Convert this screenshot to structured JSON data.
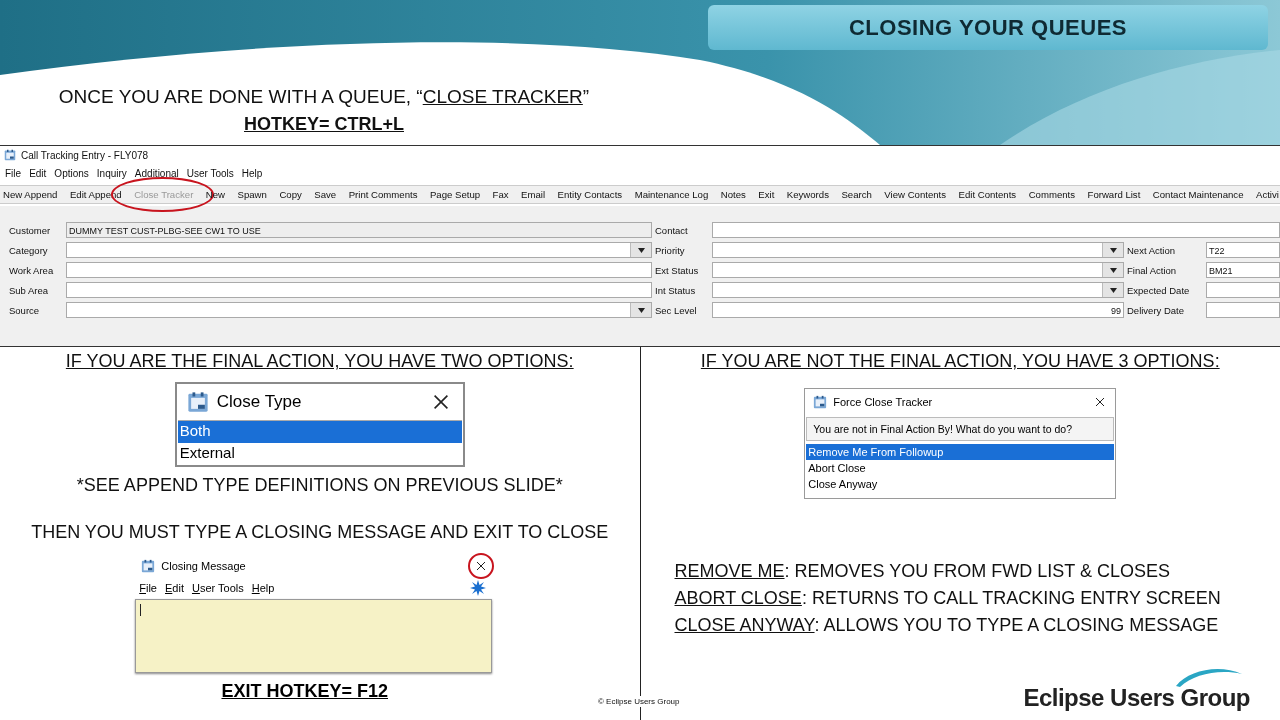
{
  "slide": {
    "title": "CLOSING YOUR QUEUES",
    "intro": {
      "before": "ONCE YOU ARE DONE WITH A QUEUE, “",
      "underlined": "CLOSE TRACKER",
      "after": "”"
    },
    "hotkey": "HOTKEY= CTRL+L"
  },
  "window": {
    "title": "Call Tracking Entry - FLY078",
    "menu": [
      "File",
      "Edit",
      "Options",
      "Inquiry",
      "Additional",
      "User Tools",
      "Help"
    ],
    "toolbar": [
      {
        "label": "New Append",
        "disabled": false,
        "circled": false
      },
      {
        "label": "Edit Append",
        "disabled": false,
        "circled": false
      },
      {
        "label": "Close Tracker",
        "disabled": true,
        "circled": true
      },
      {
        "label": "New",
        "disabled": false,
        "circled": false
      },
      {
        "label": "Spawn",
        "disabled": false,
        "circled": false
      },
      {
        "label": "Copy",
        "disabled": false,
        "circled": false
      },
      {
        "label": "Save",
        "disabled": false,
        "circled": false
      },
      {
        "label": "Print Comments",
        "disabled": false,
        "circled": false
      },
      {
        "label": "Page Setup",
        "disabled": false,
        "circled": false
      },
      {
        "label": "Fax",
        "disabled": false,
        "circled": false
      },
      {
        "label": "Email",
        "disabled": false,
        "circled": false
      },
      {
        "label": "Entity Contacts",
        "disabled": false,
        "circled": false
      },
      {
        "label": "Maintenance Log",
        "disabled": false,
        "circled": false
      },
      {
        "label": "Notes",
        "disabled": false,
        "circled": false
      },
      {
        "label": "Exit",
        "disabled": false,
        "circled": false
      },
      {
        "label": "Keywords",
        "disabled": false,
        "circled": false
      },
      {
        "label": "Search",
        "disabled": false,
        "circled": false
      },
      {
        "label": "View Contents",
        "disabled": false,
        "circled": false
      },
      {
        "label": "Edit Contents",
        "disabled": false,
        "circled": false
      },
      {
        "label": "Comments",
        "disabled": false,
        "circled": false
      },
      {
        "label": "Forward List",
        "disabled": false,
        "circled": false
      },
      {
        "label": "Contact Maintenance",
        "disabled": false,
        "circled": false
      },
      {
        "label": "Activi",
        "disabled": false,
        "circled": false
      }
    ],
    "fields_left": [
      {
        "label": "Customer",
        "value": "DUMMY TEST CUST-PLBG-SEE CW1 TO USE",
        "kind": "readonly"
      },
      {
        "label": "Category",
        "kind": "dropdown"
      },
      {
        "label": "Work Area",
        "kind": "text"
      },
      {
        "label": "Sub Area",
        "kind": "text"
      },
      {
        "label": "Source",
        "kind": "dropdown"
      }
    ],
    "fields_middle": [
      {
        "label": "Contact",
        "kind": "text"
      },
      {
        "label": "Priority",
        "kind": "dropdown"
      },
      {
        "label": "Ext Status",
        "kind": "dropdown"
      },
      {
        "label": "Int Status",
        "kind": "dropdown"
      },
      {
        "label": "Sec Level",
        "value": "99",
        "kind": "number"
      }
    ],
    "fields_right": [
      {
        "label": "Next Action",
        "value": "T22"
      },
      {
        "label": "Final Action",
        "value": "BM21"
      },
      {
        "label": "Expected Date"
      },
      {
        "label": "Delivery Date"
      }
    ]
  },
  "left": {
    "heading": "IF YOU ARE THE FINAL ACTION, YOU HAVE TWO OPTIONS:",
    "close_type": {
      "title": "Close Type",
      "items": [
        {
          "label": "Both",
          "selected": true
        },
        {
          "label": "External",
          "selected": false
        }
      ]
    },
    "note": "*SEE APPEND TYPE DEFINITIONS ON PREVIOUS SLIDE*",
    "instruction": "THEN YOU MUST TYPE A CLOSING MESSAGE AND EXIT TO CLOSE",
    "closing_message": {
      "title": "Closing Message",
      "close_circled": true,
      "menu": [
        "File",
        "Edit",
        "User Tools",
        "Help"
      ]
    },
    "exit_hotkey": "EXIT HOTKEY= F12"
  },
  "right": {
    "heading": "IF YOU ARE NOT THE FINAL ACTION, YOU HAVE 3 OPTIONS:",
    "force_close": {
      "title": "Force Close Tracker",
      "message": "You are not in Final Action By! What do you want to do?",
      "items": [
        {
          "label": "Remove Me From Followup",
          "selected": true
        },
        {
          "label": "Abort Close",
          "selected": false
        },
        {
          "label": "Close Anyway",
          "selected": false
        }
      ]
    },
    "explanations": [
      {
        "term": "REMOVE ME",
        "text": ": REMOVES YOU FROM FWD LIST & CLOSES"
      },
      {
        "term": "ABORT CLOSE",
        "text": ": RETURNS TO CALL TRACKING ENTRY SCREEN"
      },
      {
        "term": "CLOSE ANYWAY",
        "text": ": ALLOWS YOU TO TYPE A CLOSING MESSAGE"
      }
    ]
  },
  "footer": {
    "copyright": "© Eclipse Users Group",
    "logo": "Eclipse Users Group"
  }
}
